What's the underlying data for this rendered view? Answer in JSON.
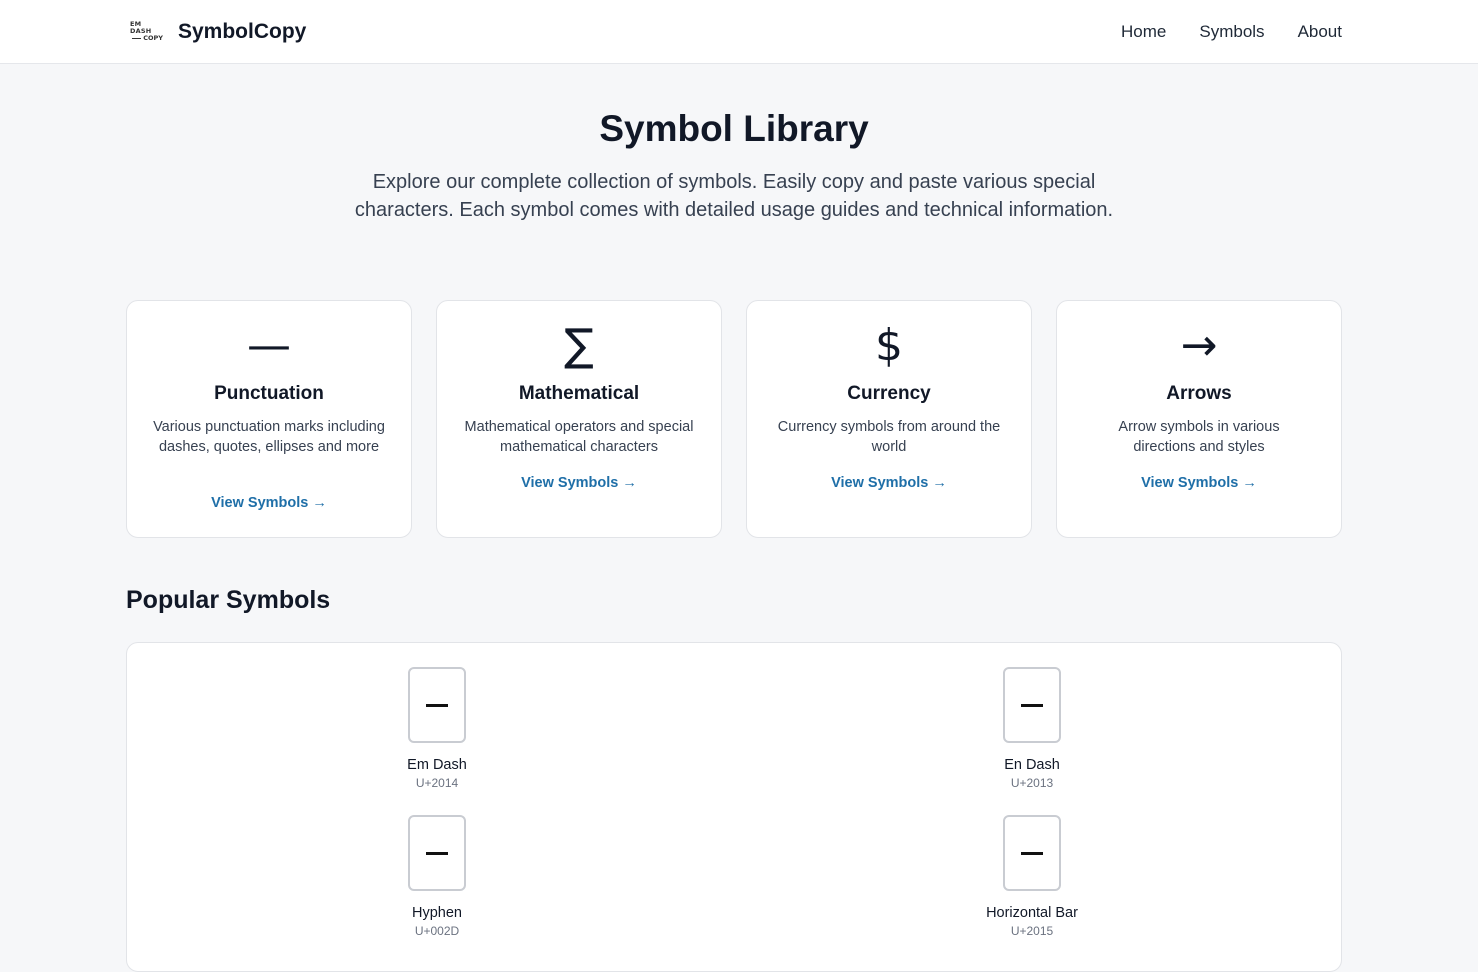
{
  "header": {
    "logo_line1": "EM DASH",
    "logo_line2": "COPY",
    "brand": "SymbolCopy",
    "nav": [
      "Home",
      "Symbols",
      "About"
    ]
  },
  "hero": {
    "title": "Symbol Library",
    "subtitle": "Explore our complete collection of symbols. Easily copy and paste various special characters. Each symbol comes with detailed usage guides and technical information."
  },
  "categories": [
    {
      "symbol": "—",
      "title": "Punctuation",
      "description": "Various punctuation marks including dashes, quotes, ellipses and more",
      "link": "View Symbols →"
    },
    {
      "symbol": "∑",
      "title": "Mathematical",
      "description": "Mathematical operators and special mathematical characters",
      "link": "View Symbols →"
    },
    {
      "symbol": "$",
      "title": "Currency",
      "description": "Currency symbols from around the world",
      "link": "View Symbols →"
    },
    {
      "symbol": "→",
      "title": "Arrows",
      "description": "Arrow symbols in various directions and styles",
      "link": "View Symbols →"
    }
  ],
  "popular": {
    "title": "Popular Symbols",
    "items": [
      {
        "name": "Em Dash",
        "code": "U+2014"
      },
      {
        "name": "En Dash",
        "code": "U+2013"
      },
      {
        "name": "Hyphen",
        "code": "U+002D"
      },
      {
        "name": "Horizontal Bar",
        "code": "U+2015"
      }
    ]
  }
}
